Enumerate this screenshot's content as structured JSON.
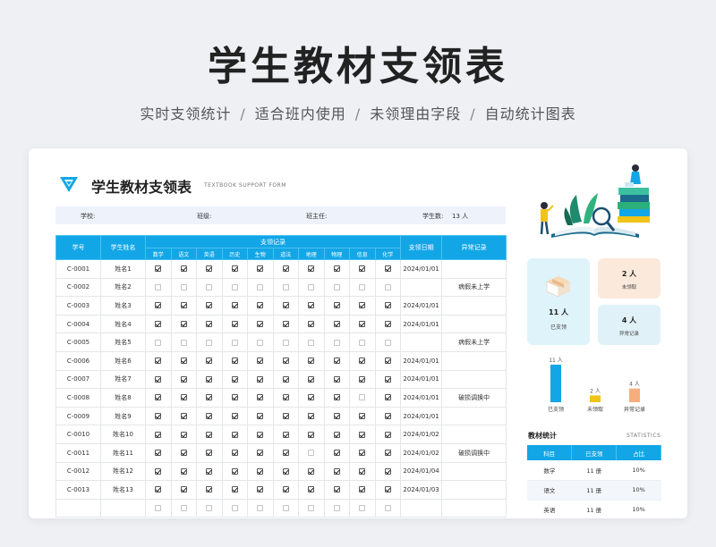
{
  "hero": {
    "title": "学生教材支领表",
    "features": [
      "实时支领统计",
      "适合班内使用",
      "未领理由字段",
      "自动统计图表"
    ],
    "separator": "/"
  },
  "form": {
    "title": "学生教材支领表",
    "subtitle": "TEXTBOOK SUPPORT FORM",
    "school_label": "学校:",
    "class_label": "班级:",
    "teacher_label": "班主任:",
    "count_label": "学生数:",
    "count_value": "13 人"
  },
  "table": {
    "headers": {
      "id": "学号",
      "name": "学生姓名",
      "group": "支领记录",
      "date": "支领日期",
      "remark": "异常记录"
    },
    "subjects": [
      "数学",
      "语文",
      "英语",
      "历史",
      "生物",
      "道法",
      "地理",
      "物理",
      "信息",
      "化学"
    ],
    "rows": [
      {
        "id": "C-0001",
        "name": "姓名1",
        "marks": [
          1,
          1,
          1,
          1,
          1,
          1,
          1,
          1,
          1,
          1
        ],
        "date": "2024/01/01",
        "remark": ""
      },
      {
        "id": "C-0002",
        "name": "姓名2",
        "marks": [
          0,
          0,
          0,
          0,
          0,
          0,
          0,
          0,
          0,
          0
        ],
        "date": "",
        "remark": "病假未上学"
      },
      {
        "id": "C-0003",
        "name": "姓名3",
        "marks": [
          1,
          1,
          1,
          1,
          1,
          1,
          1,
          1,
          1,
          1
        ],
        "date": "2024/01/01",
        "remark": ""
      },
      {
        "id": "C-0004",
        "name": "姓名4",
        "marks": [
          1,
          1,
          1,
          1,
          1,
          1,
          1,
          1,
          1,
          1
        ],
        "date": "2024/01/01",
        "remark": ""
      },
      {
        "id": "C-0005",
        "name": "姓名5",
        "marks": [
          0,
          0,
          0,
          0,
          0,
          0,
          0,
          0,
          0,
          0
        ],
        "date": "",
        "remark": "病假未上学"
      },
      {
        "id": "C-0006",
        "name": "姓名6",
        "marks": [
          1,
          1,
          1,
          1,
          1,
          1,
          1,
          1,
          1,
          1
        ],
        "date": "2024/01/01",
        "remark": ""
      },
      {
        "id": "C-0007",
        "name": "姓名7",
        "marks": [
          1,
          1,
          1,
          1,
          1,
          1,
          1,
          1,
          1,
          1
        ],
        "date": "2024/01/01",
        "remark": ""
      },
      {
        "id": "C-0008",
        "name": "姓名8",
        "marks": [
          1,
          1,
          1,
          1,
          1,
          1,
          1,
          1,
          0,
          1
        ],
        "date": "2024/01/01",
        "remark": "破损调换中"
      },
      {
        "id": "C-0009",
        "name": "姓名9",
        "marks": [
          1,
          1,
          1,
          1,
          1,
          1,
          1,
          1,
          1,
          1
        ],
        "date": "2024/01/01",
        "remark": ""
      },
      {
        "id": "C-0010",
        "name": "姓名10",
        "marks": [
          1,
          1,
          1,
          1,
          1,
          1,
          1,
          1,
          1,
          1
        ],
        "date": "2024/01/02",
        "remark": ""
      },
      {
        "id": "C-0011",
        "name": "姓名11",
        "marks": [
          1,
          1,
          1,
          1,
          1,
          1,
          0,
          1,
          1,
          1
        ],
        "date": "2024/01/02",
        "remark": "破损调换中"
      },
      {
        "id": "C-0012",
        "name": "姓名12",
        "marks": [
          1,
          1,
          1,
          1,
          1,
          1,
          1,
          1,
          1,
          1
        ],
        "date": "2024/01/04",
        "remark": ""
      },
      {
        "id": "C-0013",
        "name": "姓名13",
        "marks": [
          1,
          1,
          1,
          1,
          1,
          1,
          1,
          1,
          1,
          1
        ],
        "date": "2024/01/03",
        "remark": ""
      },
      {
        "id": "",
        "name": "",
        "marks": [
          0,
          0,
          0,
          0,
          0,
          0,
          0,
          0,
          0,
          0
        ],
        "date": "",
        "remark": ""
      }
    ]
  },
  "summary": {
    "issued": {
      "value": "11 人",
      "label": "已支领"
    },
    "unclaimed": {
      "value": "2 人",
      "label": "未领取"
    },
    "abnormal": {
      "value": "4 人",
      "label": "异常记录"
    }
  },
  "chart_data": {
    "type": "bar",
    "categories": [
      "已支领",
      "未领取",
      "异常记录"
    ],
    "values": [
      11,
      2,
      4
    ],
    "data_labels": [
      "11 人",
      "2 人",
      "4 人"
    ],
    "colors": [
      "#12a6e7",
      "#f0c419",
      "#f6ae7d"
    ],
    "ylim": [
      0,
      11
    ]
  },
  "stats": {
    "title": "教材统计",
    "subtitle": "STATISTICS",
    "headers": [
      "科目",
      "已支领",
      "占比"
    ],
    "rows": [
      [
        "数学",
        "11 册",
        "10%"
      ],
      [
        "语文",
        "11 册",
        "10%"
      ],
      [
        "英语",
        "11 册",
        "10%"
      ]
    ]
  },
  "colors": {
    "accent": "#12a6e7"
  }
}
